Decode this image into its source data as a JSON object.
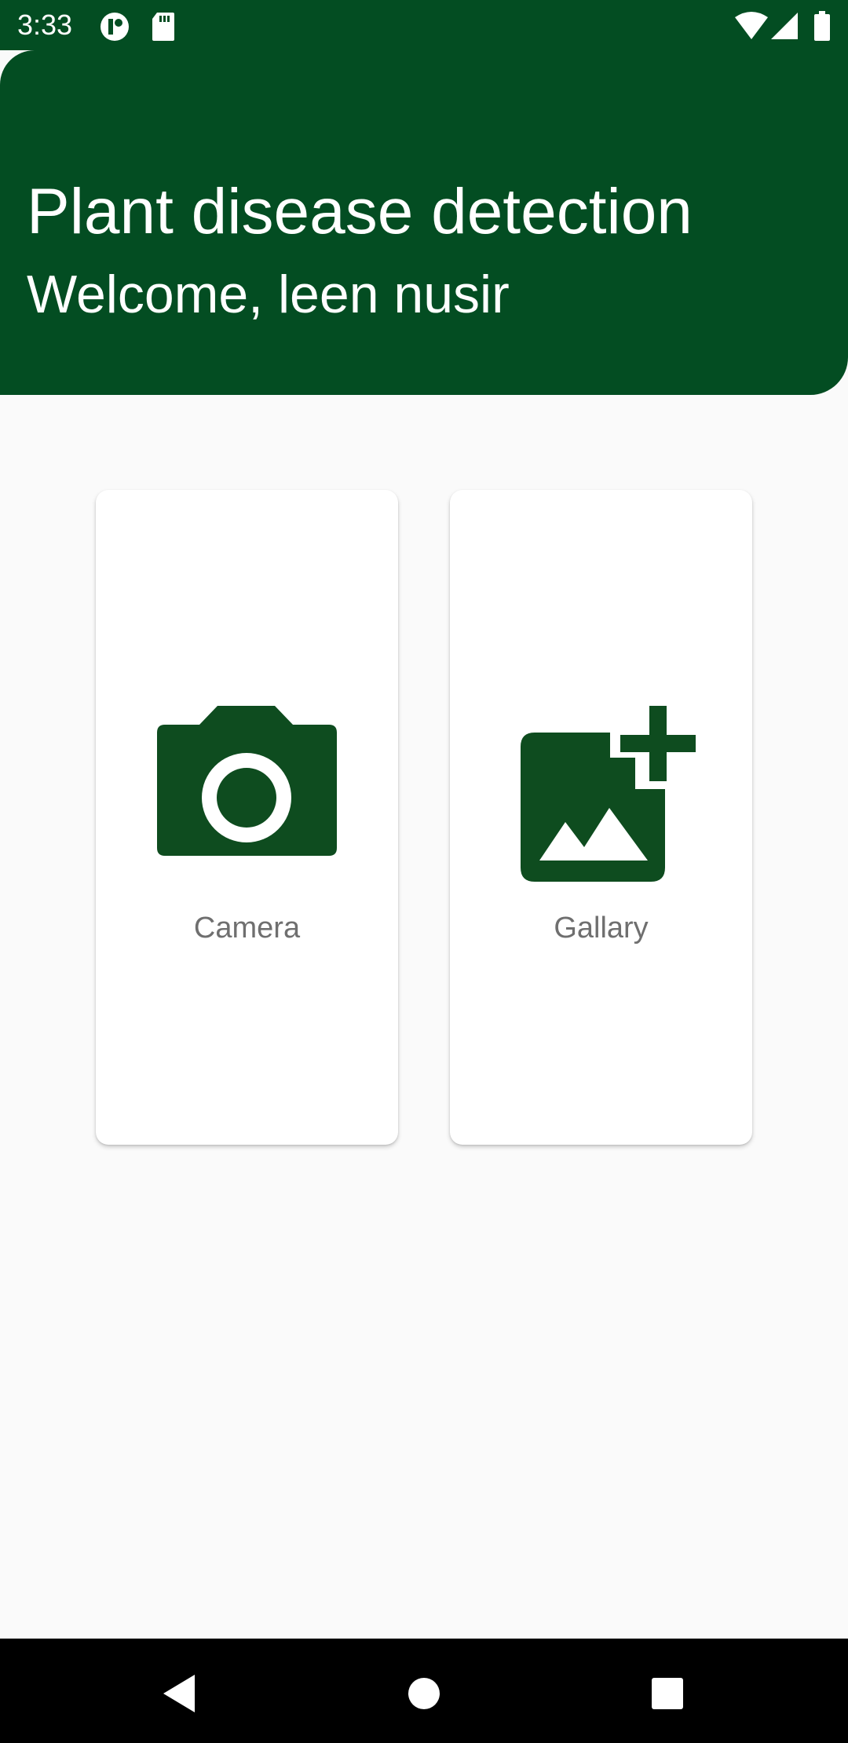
{
  "status_bar": {
    "time": "3:33",
    "left_icons": [
      "data-saver-icon",
      "sd-card-icon"
    ],
    "right_icons": [
      "wifi-icon",
      "cell-signal-icon",
      "battery-icon"
    ]
  },
  "header": {
    "title": "Plant disease detection",
    "subtitle": "Welcome, leen nusir"
  },
  "cards": [
    {
      "label": "Camera",
      "icon": "camera-icon"
    },
    {
      "label": "Gallary",
      "icon": "add-photo-icon"
    }
  ],
  "nav_bar": {
    "buttons": [
      "back-icon",
      "home-icon",
      "recents-icon"
    ]
  },
  "colors": {
    "primary": "#034d22",
    "icon": "#0e4c1f",
    "background": "#fafafa",
    "card": "#ffffff",
    "label": "#6f6f6f"
  }
}
